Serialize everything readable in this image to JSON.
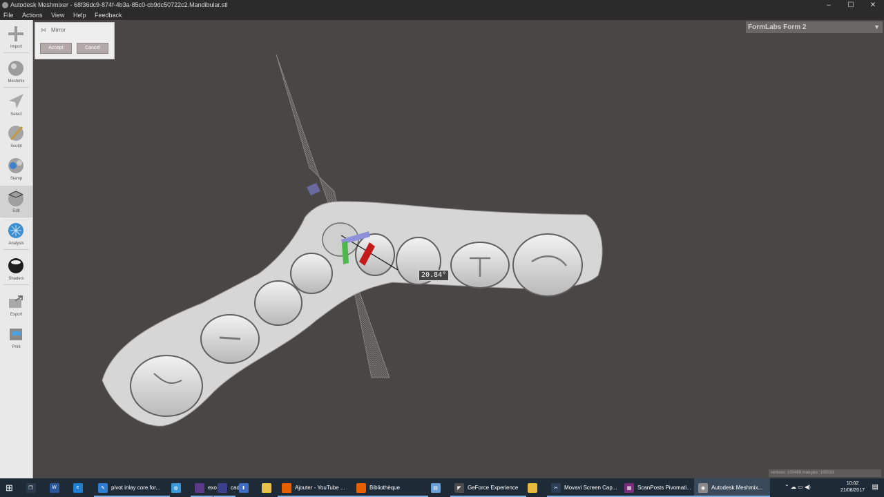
{
  "window": {
    "title": "Autodesk Meshmixer - 68f36dc9-874f-4b3a-85c0-cb9dc50722c2.Mandibular.stl",
    "controls": {
      "minimize": "–",
      "maximize": "☐",
      "close": "✕"
    }
  },
  "menu": [
    "File",
    "Actions",
    "View",
    "Help",
    "Feedback"
  ],
  "tools": [
    {
      "label": "Import",
      "icon": "plus-icon"
    },
    {
      "label": "Meshmix",
      "icon": "meshmix-sphere-icon"
    },
    {
      "label": "Select",
      "icon": "select-arrow-icon"
    },
    {
      "label": "Sculpt",
      "icon": "sculpt-brush-icon"
    },
    {
      "label": "Stamp",
      "icon": "stamp-icon"
    },
    {
      "label": "Edit",
      "icon": "edit-sphere-icon",
      "active": true
    },
    {
      "label": "Analysis",
      "icon": "analysis-sphere-icon"
    },
    {
      "label": "Shaders",
      "icon": "shader-ball-icon"
    },
    {
      "label": "Export",
      "icon": "export-icon"
    },
    {
      "label": "Print",
      "icon": "print-icon"
    }
  ],
  "mirror_panel": {
    "title": "Mirror",
    "accept": "Accept",
    "cancel": "Cancel"
  },
  "printer": {
    "name": "FormLabs Form 2",
    "arrow": "▼"
  },
  "viewport": {
    "angle_label": "20.84°"
  },
  "status": {
    "text": "vertices: 100489 triangles: 199333"
  },
  "taskbar": {
    "start": "⊞",
    "pinned": [
      {
        "label": "",
        "icon": "task-view-icon",
        "color": "#2b3a4a",
        "glyph": "❐"
      },
      {
        "label": "",
        "icon": "word-icon",
        "color": "#2b579a",
        "glyph": "W"
      },
      {
        "label": "",
        "icon": "edge-icon",
        "color": "#1e7fd0",
        "glyph": "e"
      },
      {
        "label": "pivot inlay core.for...",
        "icon": "app-icon",
        "color": "#2d7dd2",
        "glyph": "✎"
      },
      {
        "label": "",
        "icon": "app-icon",
        "color": "#3a9ad9",
        "glyph": "◍"
      },
      {
        "label": "exo",
        "icon": "exo-icon",
        "color": "#5c3a8a",
        "glyph": ""
      },
      {
        "label": "cad",
        "icon": "cad-icon",
        "color": "#3c3f8a",
        "glyph": ""
      },
      {
        "label": "",
        "icon": "upload-icon",
        "color": "#3f6fc4",
        "glyph": "⬆"
      },
      {
        "label": "",
        "icon": "notes-icon",
        "color": "#e7c14a",
        "glyph": ""
      },
      {
        "label": "Ajouter - YouTube ...",
        "icon": "firefox-icon",
        "color": "#e66000",
        "glyph": ""
      },
      {
        "label": "Bibliothèque",
        "icon": "firefox-icon",
        "color": "#e66000",
        "glyph": ""
      },
      {
        "label": "",
        "icon": "app-icon",
        "color": "#6aa0d8",
        "glyph": "▤"
      },
      {
        "label": "GeForce Experience",
        "icon": "geforce-icon",
        "color": "#4c4c4c",
        "glyph": "◤"
      },
      {
        "label": "",
        "icon": "folder-icon",
        "color": "#e8b93f",
        "glyph": ""
      },
      {
        "label": "Movavi Screen Cap...",
        "icon": "movavi-icon",
        "color": "#2c3f55",
        "glyph": "✂"
      },
      {
        "label": "ScanPosts Pivomati...",
        "icon": "app-icon",
        "color": "#7a2d7a",
        "glyph": "▦"
      },
      {
        "label": "Autodesk Meshmix...",
        "icon": "meshmixer-icon",
        "color": "#8a8a8a",
        "glyph": "◉",
        "active": true
      }
    ],
    "clock": {
      "time": "10:02",
      "date": "21/08/2017"
    }
  }
}
